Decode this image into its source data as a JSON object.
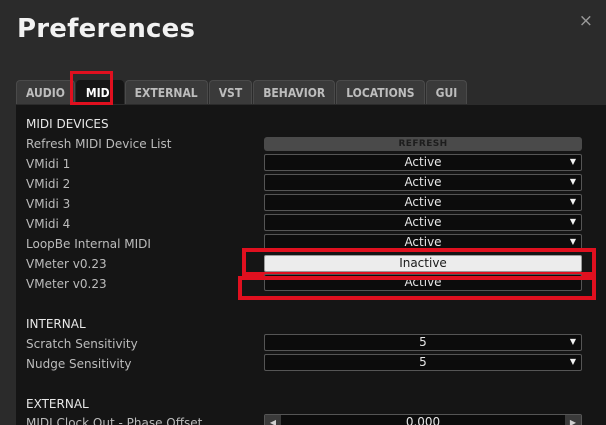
{
  "window": {
    "title": "Preferences",
    "close_glyph": "×"
  },
  "tabs": [
    {
      "label": "AUDIO"
    },
    {
      "label": "MIDI"
    },
    {
      "label": "EXTERNAL"
    },
    {
      "label": "VST"
    },
    {
      "label": "BEHAVIOR"
    },
    {
      "label": "LOCATIONS"
    },
    {
      "label": "GUI"
    }
  ],
  "active_tab": "MIDI",
  "midi_devices": {
    "heading": "MIDI DEVICES",
    "refresh_label": "Refresh MIDI Device List",
    "refresh_button": "REFRESH",
    "devices": [
      {
        "name": "VMidi 1",
        "value": "Active"
      },
      {
        "name": "VMidi 2",
        "value": "Active"
      },
      {
        "name": "VMidi 3",
        "value": "Active"
      },
      {
        "name": "VMidi 4",
        "value": "Active"
      },
      {
        "name": "LoopBe Internal MIDI",
        "value": "Active"
      },
      {
        "name": "VMeter v0.23",
        "value": "Inactive"
      },
      {
        "name": "VMeter v0.23",
        "value": "Active"
      }
    ]
  },
  "internal": {
    "heading": "INTERNAL",
    "rows": [
      {
        "name": "Scratch Sensitivity",
        "value": "5"
      },
      {
        "name": "Nudge Sensitivity",
        "value": "5"
      }
    ]
  },
  "external": {
    "heading": "EXTERNAL",
    "rows": [
      {
        "name": "MIDI Clock Out - Phase Offset",
        "value": "0.000"
      }
    ]
  },
  "icons": {
    "close": "close-icon",
    "dropdown_arrow": "caret-down-icon",
    "stepper_left": "caret-left-icon",
    "stepper_right": "caret-right-icon"
  },
  "colors": {
    "highlight": "#e0101f",
    "panel_bg": "#151515",
    "window_bg": "#2b2b2b"
  }
}
